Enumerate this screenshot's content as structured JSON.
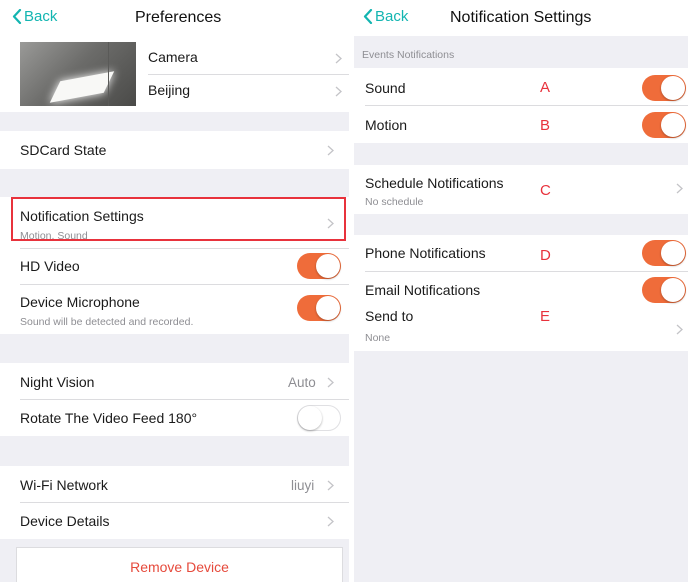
{
  "left": {
    "back_label": "Back",
    "title": "Preferences",
    "camera_name": "Camera",
    "location": "Beijing",
    "sdcard_label": "SDCard State",
    "notification": {
      "label": "Notification Settings",
      "subtitle": "Motion, Sound"
    },
    "hd_video": {
      "label": "HD Video",
      "on": true
    },
    "microphone": {
      "label": "Device Microphone",
      "subtitle": "Sound will be detected and recorded.",
      "on": true
    },
    "night_vision": {
      "label": "Night Vision",
      "value": "Auto"
    },
    "rotate": {
      "label": "Rotate The Video Feed 180°",
      "on": false
    },
    "wifi": {
      "label": "Wi-Fi Network",
      "value": "liuyi"
    },
    "device_details_label": "Device Details",
    "remove_label": "Remove Device"
  },
  "right": {
    "back_label": "Back",
    "title": "Notification Settings",
    "events_header": "Events Notifications",
    "sound": {
      "label": "Sound",
      "on": true,
      "annotation": "A"
    },
    "motion": {
      "label": "Motion",
      "on": true,
      "annotation": "B"
    },
    "schedule": {
      "label": "Schedule Notifications",
      "subtitle": "No schedule",
      "annotation": "C"
    },
    "phone": {
      "label": "Phone Notifications",
      "on": true,
      "annotation": "D"
    },
    "email": {
      "label": "Email Notifications",
      "on": true
    },
    "send_to": {
      "label": "Send to",
      "value": "None",
      "annotation": "E"
    }
  },
  "colors": {
    "accent": "#13b5b1",
    "toggle_on": "#ef6c3a",
    "annotation": "#e8323c",
    "highlight_border": "#e8323c",
    "group_bg": "#efeff4"
  }
}
